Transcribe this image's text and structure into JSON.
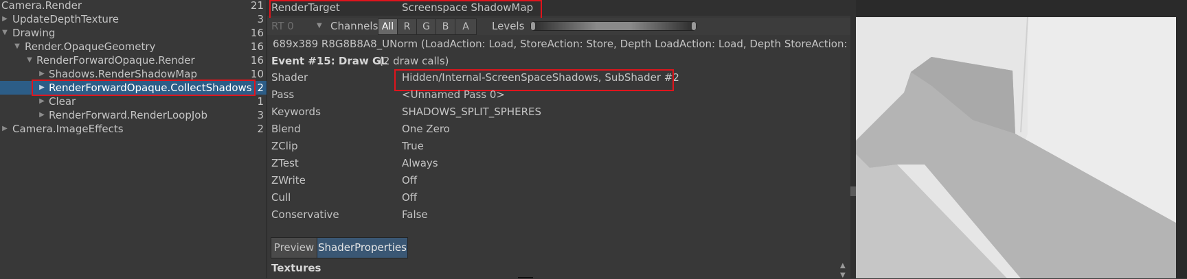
{
  "tree": {
    "items": [
      {
        "label": "Camera.Render",
        "count": "21",
        "indent": 0,
        "arrow": "",
        "selected": false
      },
      {
        "label": "UpdateDepthTexture",
        "count": "3",
        "indent": 1,
        "arrow": "▶",
        "selected": false
      },
      {
        "label": "Drawing",
        "count": "16",
        "indent": 1,
        "arrow": "▼",
        "selected": false
      },
      {
        "label": "Render.OpaqueGeometry",
        "count": "16",
        "indent": 2,
        "arrow": "▼",
        "selected": false
      },
      {
        "label": "RenderForwardOpaque.Render",
        "count": "16",
        "indent": 3,
        "arrow": "▼",
        "selected": false
      },
      {
        "label": "Shadows.RenderShadowMap",
        "count": "10",
        "indent": 4,
        "arrow": "▶",
        "selected": false
      },
      {
        "label": "RenderForwardOpaque.CollectShadows",
        "count": "2",
        "indent": 4,
        "arrow": "▶",
        "selected": true
      },
      {
        "label": "Clear",
        "count": "1",
        "indent": 4,
        "arrow": "▶",
        "selected": false
      },
      {
        "label": "RenderForward.RenderLoopJob",
        "count": "3",
        "indent": 4,
        "arrow": "▶",
        "selected": false
      },
      {
        "label": "Camera.ImageEffects",
        "count": "2",
        "indent": 1,
        "arrow": "▶",
        "selected": false
      }
    ]
  },
  "render_target": {
    "label": "RenderTarget",
    "value": "Screenspace ShadowMap"
  },
  "toolbar": {
    "rt_label": "RT 0",
    "channels_label": "Channels",
    "channels": [
      "All",
      "R",
      "G",
      "B",
      "A"
    ],
    "levels_label": "Levels"
  },
  "target_info": "689x389 R8G8B8A8_UNorm (LoadAction: Load, StoreAction: Store, Depth LoadAction: Load, Depth StoreAction: Store",
  "event": {
    "title": "Event #15: Draw GL",
    "calls": "(2 draw calls)"
  },
  "properties": [
    {
      "key": "Shader",
      "value": "Hidden/Internal-ScreenSpaceShadows, SubShader #2"
    },
    {
      "key": "Pass",
      "value": "<Unnamed Pass 0>"
    },
    {
      "key": "Keywords",
      "value": "SHADOWS_SPLIT_SPHERES"
    },
    {
      "key": "Blend",
      "value": "One Zero"
    },
    {
      "key": "ZClip",
      "value": "True"
    },
    {
      "key": "ZTest",
      "value": "Always"
    },
    {
      "key": "ZWrite",
      "value": "Off"
    },
    {
      "key": "Cull",
      "value": "Off"
    },
    {
      "key": "Conservative",
      "value": "False"
    }
  ],
  "tabs": [
    "Preview",
    "ShaderProperties"
  ],
  "textures_label": "Textures",
  "colors": {
    "panel": "#383838",
    "selection": "#2c5d87",
    "highlight_box": "#e0141c",
    "active_tab": "#3a5774"
  }
}
